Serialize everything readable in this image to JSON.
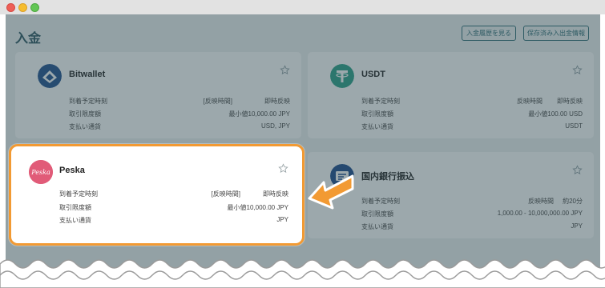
{
  "window": {
    "traffic_lights": [
      "red",
      "yellow",
      "green"
    ]
  },
  "header": {
    "title": "入金",
    "history_button": "入金履歴を見る",
    "saved_button": "保存済み入出金情報"
  },
  "labels": {
    "arrival": "到着予定時刻",
    "limit": "取引限度額",
    "currency": "支払い通貨"
  },
  "cards": [
    {
      "name": "Bitwallet",
      "arrival_note": "[反映時間]",
      "arrival": "即時反映",
      "limit": "最小値10,000.00 JPY",
      "currency": "USD, JPY",
      "logo_color": "#1f4f8f"
    },
    {
      "name": "USDT",
      "arrival_note": "反映時間",
      "arrival": "即時反映",
      "limit": "最小値100.00 USD",
      "currency": "USDT",
      "logo_color": "#2aa086"
    },
    {
      "name": "Peska",
      "arrival_note": "[反映時間]",
      "arrival": "即時反映",
      "limit": "最小値10,000.00 JPY",
      "currency": "JPY",
      "logo_color": "#e15b78",
      "logo_text": "Peska"
    },
    {
      "name": "国内銀行振込",
      "arrival_note": "反映時間",
      "arrival": "約20分",
      "limit": "1,000.00 - 10,000,000.00 JPY",
      "currency": "JPY",
      "logo_color": "#1c4a8c"
    }
  ],
  "colors": {
    "highlight": "#f29a33",
    "accent": "#2c6b75"
  }
}
